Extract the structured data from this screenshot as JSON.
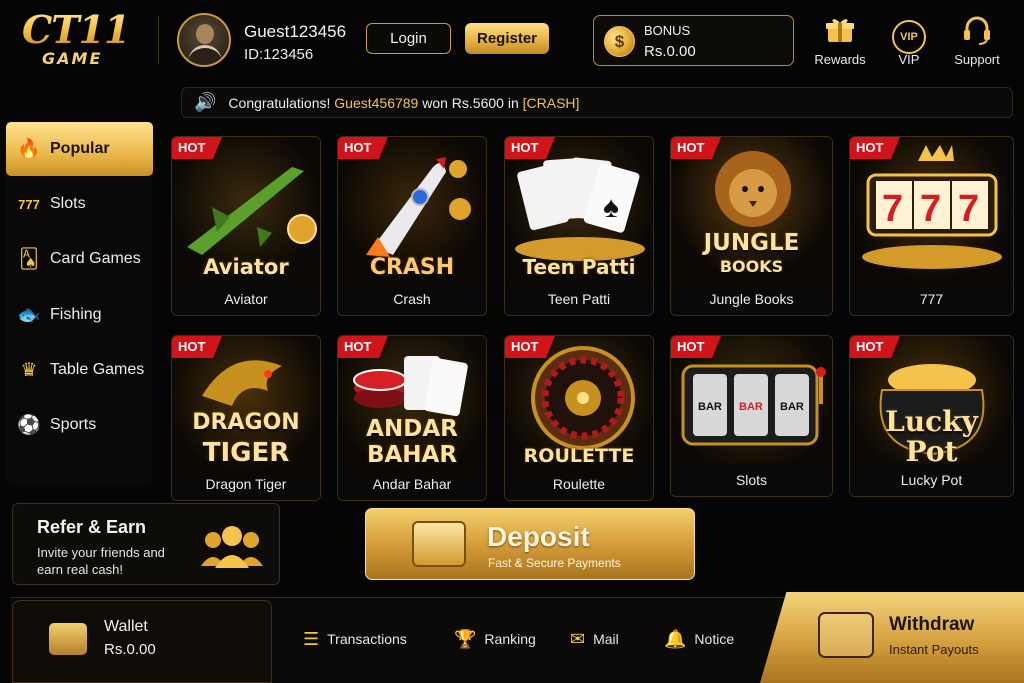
{
  "header": {
    "logo_main": "CT11",
    "logo_sub": "GAME",
    "username": "Guest123456",
    "user_id": "ID:123456",
    "login_label": "Login",
    "register_label": "Register",
    "bonus_label": "BONUS",
    "bonus_value": "Rs.0.00",
    "icons": [
      {
        "label": "Rewards",
        "icon": "gift-icon"
      },
      {
        "label": "VIP",
        "icon": "vip-icon"
      },
      {
        "label": "Support",
        "icon": "headset-icon"
      }
    ]
  },
  "marquee": {
    "prefix": "Congratulations!",
    "winner": "Guest456789",
    "mid": "won Rs.5600 in",
    "game": "[CRASH]"
  },
  "sidebar": {
    "items": [
      {
        "label": "Popular",
        "icon": "fire-icon",
        "active": true
      },
      {
        "label": "Slots",
        "icon": "slot-777-icon"
      },
      {
        "label": "Card Games",
        "icon": "cards-icon"
      },
      {
        "label": "Fishing",
        "icon": "fish-icon"
      },
      {
        "label": "Table Games",
        "icon": "crown-icon"
      },
      {
        "label": "Sports",
        "icon": "soccer-ball-icon"
      }
    ]
  },
  "games": [
    {
      "name": "Aviator",
      "badge": "HOT",
      "art_title": "Aviator"
    },
    {
      "name": "Crash",
      "badge": "HOT",
      "art_title": "CRASH"
    },
    {
      "name": "Teen Patti",
      "badge": "HOT",
      "art_title": "Teen Patti"
    },
    {
      "name": "Jungle Books",
      "badge": "HOT",
      "art_title": "JUNGLE",
      "art_title2": "BOOKS"
    },
    {
      "name": "777",
      "badge": "HOT",
      "art_title": "777"
    },
    {
      "name": "Dragon Tiger",
      "badge": "HOT",
      "art_title": "DRAGON",
      "art_title2": "TIGER"
    },
    {
      "name": "Andar Bahar",
      "badge": "HOT",
      "art_title": "ANDAR",
      "art_title2": "BAHAR"
    },
    {
      "name": "Roulette",
      "badge": "HOT",
      "art_title": "ROULETTE"
    },
    {
      "name": "Slots",
      "badge": "HOT",
      "art_title": "BAR BAR BAR"
    },
    {
      "name": "Lucky Pot",
      "badge": "HOT",
      "art_title": "Lucky",
      "art_title2": "Pot"
    }
  ],
  "refer": {
    "title": "Refer & Earn",
    "subtitle": "Invite your friends and earn real cash!"
  },
  "deposit": {
    "title": "Deposit",
    "subtitle": "Fast & Secure Payments"
  },
  "bottom": {
    "wallet_label": "Wallet",
    "wallet_value": "Rs.0.00",
    "nav": [
      {
        "label": "Transactions",
        "icon": "list-icon"
      },
      {
        "label": "Ranking",
        "icon": "trophy-icon"
      },
      {
        "label": "Mail",
        "icon": "mail-icon"
      },
      {
        "label": "Notice",
        "icon": "bell-icon"
      }
    ],
    "withdraw_title": "Withdraw",
    "withdraw_subtitle": "Instant Payouts"
  },
  "colors": {
    "accent": "#f3c34b",
    "background": "#050505",
    "hot_badge": "#d0141a"
  }
}
